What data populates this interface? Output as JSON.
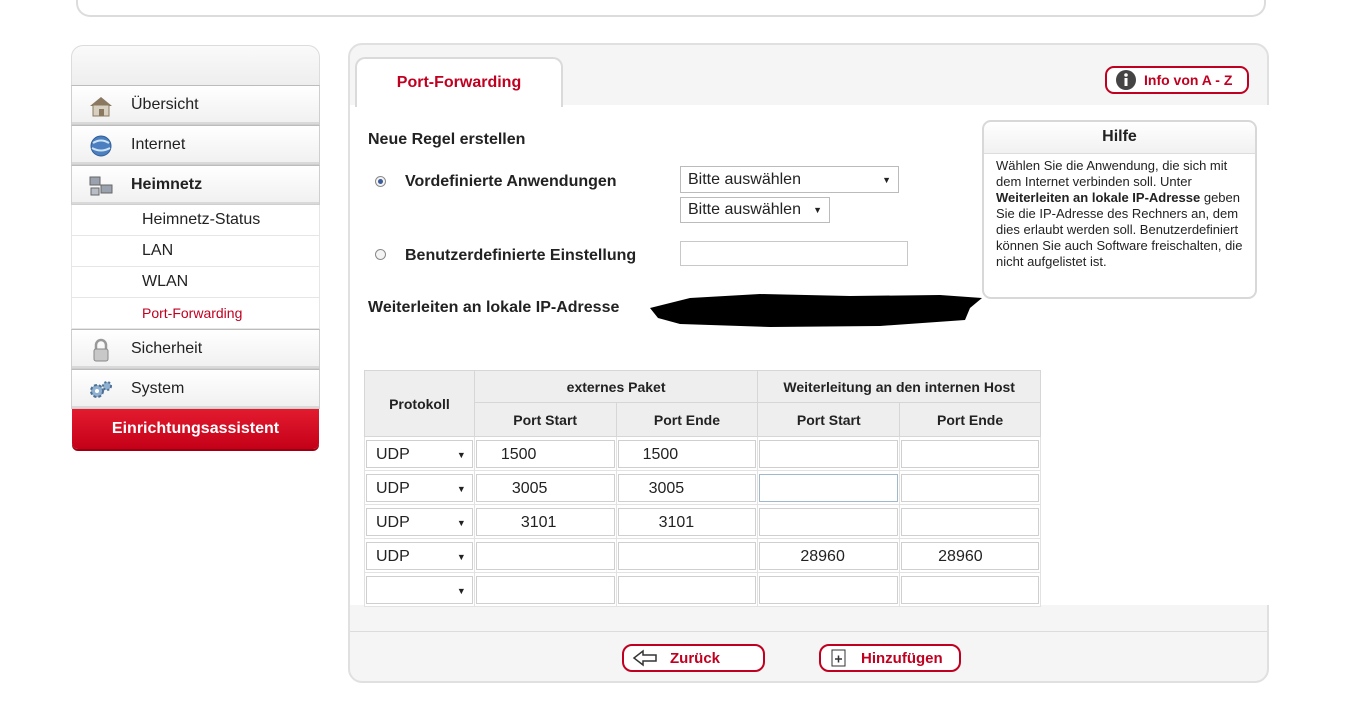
{
  "tab": {
    "title": "Port-Forwarding"
  },
  "info_button": {
    "label": "Info von A - Z"
  },
  "sidebar": {
    "items": [
      {
        "label": "Übersicht",
        "icon": "home-icon"
      },
      {
        "label": "Internet",
        "icon": "globe-icon"
      },
      {
        "label": "Heimnetz",
        "icon": "network-icon",
        "active": true
      },
      {
        "label": "Sicherheit",
        "icon": "lock-icon"
      },
      {
        "label": "System",
        "icon": "gears-icon"
      }
    ],
    "subitems": [
      "Heimnetz-Status",
      "LAN",
      "WLAN",
      "Port-Forwarding"
    ],
    "wizard": "Einrichtungsassistent"
  },
  "form": {
    "heading": "Neue Regel erstellen",
    "option_predefined": "Vordefinierte Anwendungen",
    "option_custom": "Benutzerdefinierte Einstellung",
    "select1": "Bitte auswählen",
    "select2": "Bitte auswählen",
    "forward_label": "Weiterleiten an lokale IP-Adresse"
  },
  "help": {
    "title": "Hilfe",
    "text_1": "Wählen Sie die Anwendung, die sich mit dem Internet verbinden soll. Unter ",
    "text_bold": "Weiterleiten an lokale IP-Adresse",
    "text_2": " geben Sie die IP-Adresse des Rechners an, dem dies erlaubt werden soll. Benutzerdefiniert können Sie auch Software freischalten, die nicht aufgelistet ist."
  },
  "table": {
    "headers": {
      "protocol": "Protokoll",
      "external": "externes Paket",
      "internal": "Weiterleitung an den internen Host",
      "port_start": "Port Start",
      "port_end": "Port Ende"
    },
    "rows": [
      {
        "protocol": "UDP",
        "ext_start": "1500",
        "ext_end": "1500",
        "int_start": "",
        "int_end": ""
      },
      {
        "protocol": "UDP",
        "ext_start": "3005",
        "ext_end": "3005",
        "int_start": "",
        "int_end": ""
      },
      {
        "protocol": "UDP",
        "ext_start": "3101",
        "ext_end": "3101",
        "int_start": "",
        "int_end": ""
      },
      {
        "protocol": "UDP",
        "ext_start": "",
        "ext_end": "",
        "int_start": "28960",
        "int_end": "28960"
      },
      {
        "protocol": "",
        "ext_start": "",
        "ext_end": "",
        "int_start": "",
        "int_end": ""
      }
    ]
  },
  "buttons": {
    "back": "Zurück",
    "add": "Hinzufügen"
  },
  "colors": {
    "accent": "#c00020",
    "wizard": "#d6001c"
  }
}
